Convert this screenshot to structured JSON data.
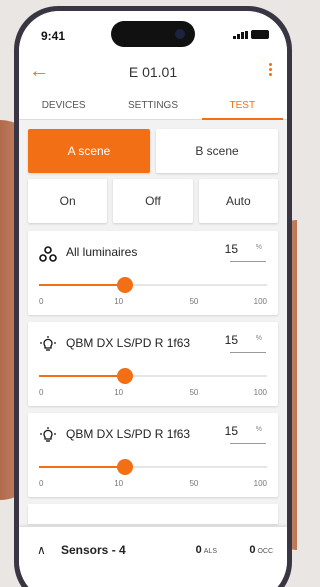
{
  "status": {
    "time": "9:41"
  },
  "header": {
    "title": "E 01.01",
    "back_icon": "arrow-left-icon",
    "menu_icon": "kebab-menu-icon"
  },
  "tabs": [
    {
      "label": "DEVICES"
    },
    {
      "label": "SETTINGS"
    },
    {
      "label": "TEST",
      "active": true
    }
  ],
  "scenes": [
    {
      "label": "A scene",
      "selected": true
    },
    {
      "label": "B scene",
      "selected": false
    }
  ],
  "modes": [
    {
      "label": "On"
    },
    {
      "label": "Off"
    },
    {
      "label": "Auto"
    }
  ],
  "cards": [
    {
      "label": "All luminaires",
      "icon": "luminaire-group-icon",
      "value": "15",
      "unit": "%",
      "slider_value": 15
    },
    {
      "label": "QBM DX LS/PD R 1f63",
      "icon": "light-bulb-icon",
      "value": "15",
      "unit": "%",
      "slider_value": 15
    },
    {
      "label": "QBM DX LS/PD R 1f63",
      "icon": "light-bulb-icon",
      "value": "15",
      "unit": "%",
      "slider_value": 15
    }
  ],
  "slider_ticks": [
    "0",
    "10",
    "50",
    "100"
  ],
  "sensors": {
    "label": "Sensors - 4",
    "als_value": "0",
    "als_unit": "ALS",
    "occ_value": "0",
    "occ_unit": "OCC"
  },
  "colors": {
    "accent": "#f36f16"
  }
}
